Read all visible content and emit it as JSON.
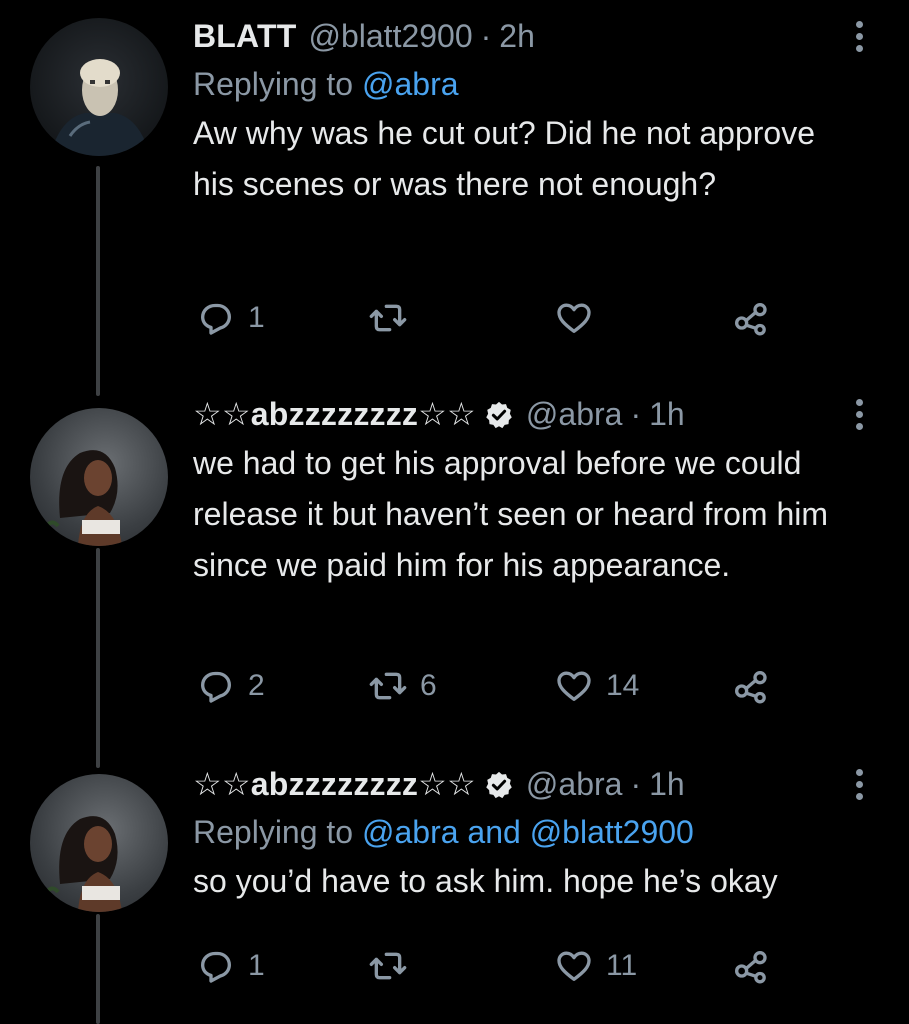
{
  "tweets": [
    {
      "name": "BLATT",
      "handle": "@blatt2900",
      "time": "2h",
      "reply_prefix": "Replying to",
      "reply_links": "@abra",
      "reply_conj": "",
      "reply_links2": "",
      "text": "Aw why was he cut out? Did he not approve his scenes or was there not enough?",
      "replies": "1",
      "retweets": "",
      "likes": ""
    },
    {
      "name": "☆☆abzzzzzzzz☆☆",
      "handle": "@abra",
      "time": "1h",
      "text": "we had to get his approval before we could release it but haven’t seen or heard from him since we paid him for his appearance.",
      "replies": "2",
      "retweets": "6",
      "likes": "14"
    },
    {
      "name": "☆☆abzzzzzzzz☆☆",
      "handle": "@abra",
      "time": "1h",
      "reply_prefix": "Replying to",
      "reply_links": "@abra",
      "reply_conj": "and",
      "reply_links2": "@blatt2900",
      "text": "so you’d have to ask him. hope he’s okay",
      "replies": "1",
      "retweets": "",
      "likes": "11"
    }
  ],
  "separator": "·",
  "colors": {
    "background": "#000000",
    "text": "#e7e9ea",
    "muted": "#8b98a5",
    "link": "#4aa3ef",
    "thread_line": "#3e4144"
  },
  "icons": [
    "reply-icon",
    "retweet-icon",
    "like-icon",
    "share-icon",
    "verified-badge-icon",
    "more-options-icon"
  ]
}
